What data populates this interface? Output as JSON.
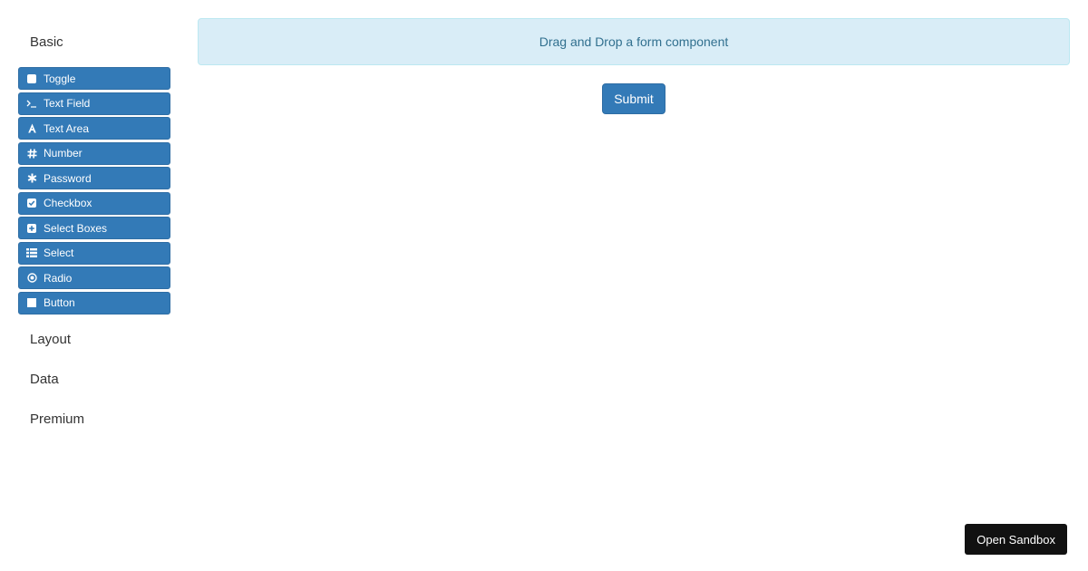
{
  "sidebar": {
    "groups": {
      "basic": "Basic",
      "layout": "Layout",
      "data": "Data",
      "premium": "Premium"
    },
    "components": [
      {
        "label": "Toggle",
        "icon": "toggle-icon"
      },
      {
        "label": "Text Field",
        "icon": "terminal-icon"
      },
      {
        "label": "Text Area",
        "icon": "font-icon"
      },
      {
        "label": "Number",
        "icon": "hashtag-icon"
      },
      {
        "label": "Password",
        "icon": "asterisk-icon"
      },
      {
        "label": "Checkbox",
        "icon": "check-square-icon"
      },
      {
        "label": "Select Boxes",
        "icon": "plus-square-icon"
      },
      {
        "label": "Select",
        "icon": "list-icon"
      },
      {
        "label": "Radio",
        "icon": "dot-circle-icon"
      },
      {
        "label": "Button",
        "icon": "stop-icon"
      }
    ]
  },
  "main": {
    "dropzone_text": "Drag and Drop a form component",
    "submit_label": "Submit"
  },
  "sandbox_label": "Open Sandbox",
  "colors": {
    "primary": "#337ab7",
    "info_bg": "#d9edf7",
    "info_text": "#31708f",
    "dark": "#111111"
  }
}
